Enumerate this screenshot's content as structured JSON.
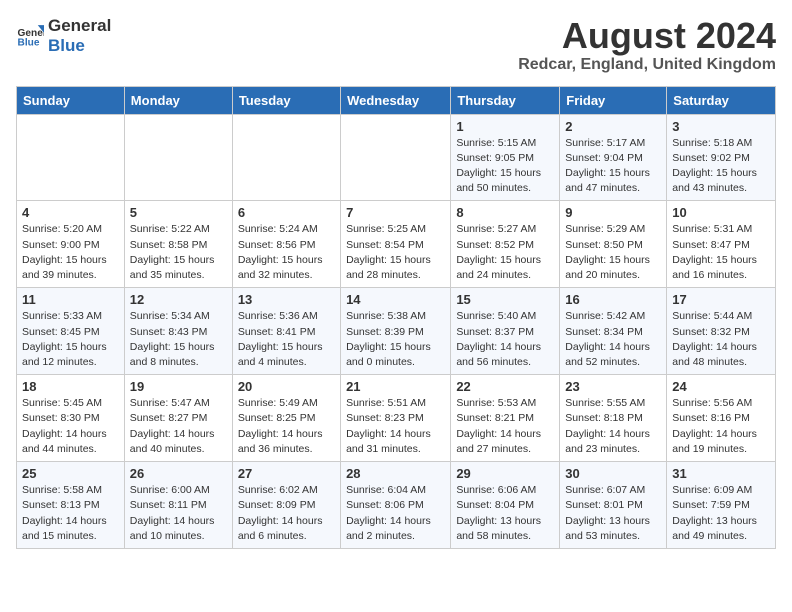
{
  "header": {
    "logo_general": "General",
    "logo_blue": "Blue",
    "month_title": "August 2024",
    "location": "Redcar, England, United Kingdom"
  },
  "days_of_week": [
    "Sunday",
    "Monday",
    "Tuesday",
    "Wednesday",
    "Thursday",
    "Friday",
    "Saturday"
  ],
  "weeks": [
    [
      {
        "day": "",
        "info": ""
      },
      {
        "day": "",
        "info": ""
      },
      {
        "day": "",
        "info": ""
      },
      {
        "day": "",
        "info": ""
      },
      {
        "day": "1",
        "info": "Sunrise: 5:15 AM\nSunset: 9:05 PM\nDaylight: 15 hours\nand 50 minutes."
      },
      {
        "day": "2",
        "info": "Sunrise: 5:17 AM\nSunset: 9:04 PM\nDaylight: 15 hours\nand 47 minutes."
      },
      {
        "day": "3",
        "info": "Sunrise: 5:18 AM\nSunset: 9:02 PM\nDaylight: 15 hours\nand 43 minutes."
      }
    ],
    [
      {
        "day": "4",
        "info": "Sunrise: 5:20 AM\nSunset: 9:00 PM\nDaylight: 15 hours\nand 39 minutes."
      },
      {
        "day": "5",
        "info": "Sunrise: 5:22 AM\nSunset: 8:58 PM\nDaylight: 15 hours\nand 35 minutes."
      },
      {
        "day": "6",
        "info": "Sunrise: 5:24 AM\nSunset: 8:56 PM\nDaylight: 15 hours\nand 32 minutes."
      },
      {
        "day": "7",
        "info": "Sunrise: 5:25 AM\nSunset: 8:54 PM\nDaylight: 15 hours\nand 28 minutes."
      },
      {
        "day": "8",
        "info": "Sunrise: 5:27 AM\nSunset: 8:52 PM\nDaylight: 15 hours\nand 24 minutes."
      },
      {
        "day": "9",
        "info": "Sunrise: 5:29 AM\nSunset: 8:50 PM\nDaylight: 15 hours\nand 20 minutes."
      },
      {
        "day": "10",
        "info": "Sunrise: 5:31 AM\nSunset: 8:47 PM\nDaylight: 15 hours\nand 16 minutes."
      }
    ],
    [
      {
        "day": "11",
        "info": "Sunrise: 5:33 AM\nSunset: 8:45 PM\nDaylight: 15 hours\nand 12 minutes."
      },
      {
        "day": "12",
        "info": "Sunrise: 5:34 AM\nSunset: 8:43 PM\nDaylight: 15 hours\nand 8 minutes."
      },
      {
        "day": "13",
        "info": "Sunrise: 5:36 AM\nSunset: 8:41 PM\nDaylight: 15 hours\nand 4 minutes."
      },
      {
        "day": "14",
        "info": "Sunrise: 5:38 AM\nSunset: 8:39 PM\nDaylight: 15 hours\nand 0 minutes."
      },
      {
        "day": "15",
        "info": "Sunrise: 5:40 AM\nSunset: 8:37 PM\nDaylight: 14 hours\nand 56 minutes."
      },
      {
        "day": "16",
        "info": "Sunrise: 5:42 AM\nSunset: 8:34 PM\nDaylight: 14 hours\nand 52 minutes."
      },
      {
        "day": "17",
        "info": "Sunrise: 5:44 AM\nSunset: 8:32 PM\nDaylight: 14 hours\nand 48 minutes."
      }
    ],
    [
      {
        "day": "18",
        "info": "Sunrise: 5:45 AM\nSunset: 8:30 PM\nDaylight: 14 hours\nand 44 minutes."
      },
      {
        "day": "19",
        "info": "Sunrise: 5:47 AM\nSunset: 8:27 PM\nDaylight: 14 hours\nand 40 minutes."
      },
      {
        "day": "20",
        "info": "Sunrise: 5:49 AM\nSunset: 8:25 PM\nDaylight: 14 hours\nand 36 minutes."
      },
      {
        "day": "21",
        "info": "Sunrise: 5:51 AM\nSunset: 8:23 PM\nDaylight: 14 hours\nand 31 minutes."
      },
      {
        "day": "22",
        "info": "Sunrise: 5:53 AM\nSunset: 8:21 PM\nDaylight: 14 hours\nand 27 minutes."
      },
      {
        "day": "23",
        "info": "Sunrise: 5:55 AM\nSunset: 8:18 PM\nDaylight: 14 hours\nand 23 minutes."
      },
      {
        "day": "24",
        "info": "Sunrise: 5:56 AM\nSunset: 8:16 PM\nDaylight: 14 hours\nand 19 minutes."
      }
    ],
    [
      {
        "day": "25",
        "info": "Sunrise: 5:58 AM\nSunset: 8:13 PM\nDaylight: 14 hours\nand 15 minutes."
      },
      {
        "day": "26",
        "info": "Sunrise: 6:00 AM\nSunset: 8:11 PM\nDaylight: 14 hours\nand 10 minutes."
      },
      {
        "day": "27",
        "info": "Sunrise: 6:02 AM\nSunset: 8:09 PM\nDaylight: 14 hours\nand 6 minutes."
      },
      {
        "day": "28",
        "info": "Sunrise: 6:04 AM\nSunset: 8:06 PM\nDaylight: 14 hours\nand 2 minutes."
      },
      {
        "day": "29",
        "info": "Sunrise: 6:06 AM\nSunset: 8:04 PM\nDaylight: 13 hours\nand 58 minutes."
      },
      {
        "day": "30",
        "info": "Sunrise: 6:07 AM\nSunset: 8:01 PM\nDaylight: 13 hours\nand 53 minutes."
      },
      {
        "day": "31",
        "info": "Sunrise: 6:09 AM\nSunset: 7:59 PM\nDaylight: 13 hours\nand 49 minutes."
      }
    ]
  ]
}
